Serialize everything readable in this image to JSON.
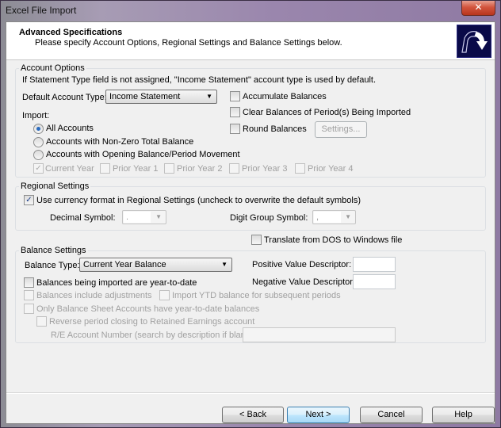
{
  "window": {
    "title": "Excel File Import",
    "close_label": "x"
  },
  "header": {
    "title": "Advanced Specifications",
    "subtitle": "Please specify Account Options, Regional Settings and Balance Settings below.",
    "icon": "wizard-arrow-icon"
  },
  "account_options": {
    "legend": "Account Options",
    "note": "If Statement Type field is not assigned, \"Income Statement\" account type is used by default.",
    "default_account_type_label": "Default Account Type:",
    "default_account_type_value": "Income Statement",
    "import_label": "Import:",
    "import_options": [
      {
        "label": "All Accounts",
        "selected": true
      },
      {
        "label": "Accounts with Non-Zero Total Balance",
        "selected": false
      },
      {
        "label": "Accounts with Opening Balance/Period Movement",
        "selected": false
      }
    ],
    "year_checkboxes": [
      {
        "label": "Current Year",
        "checked": true,
        "enabled": false
      },
      {
        "label": "Prior Year 1",
        "checked": false,
        "enabled": false
      },
      {
        "label": "Prior Year 2",
        "checked": false,
        "enabled": false
      },
      {
        "label": "Prior Year 3",
        "checked": false,
        "enabled": false
      },
      {
        "label": "Prior Year 4",
        "checked": false,
        "enabled": false
      }
    ],
    "accumulate_balances": {
      "label": "Accumulate Balances",
      "checked": false
    },
    "clear_balances": {
      "label": "Clear Balances of Period(s) Being Imported",
      "checked": false
    },
    "round_balances": {
      "label": "Round Balances",
      "checked": false
    },
    "settings_button": "Settings..."
  },
  "regional_settings": {
    "legend": "Regional Settings",
    "use_currency_format": {
      "label": "Use currency format in Regional Settings (uncheck to overwrite the default symbols)",
      "checked": true
    },
    "decimal_symbol_label": "Decimal Symbol:",
    "decimal_symbol_value": ".",
    "digit_group_symbol_label": "Digit Group Symbol:",
    "digit_group_symbol_value": ","
  },
  "translate_dos": {
    "label": "Translate from DOS to Windows file",
    "checked": false
  },
  "balance_settings": {
    "legend": "Balance Settings",
    "balance_type_label": "Balance Type:",
    "balance_type_value": "Current Year Balance",
    "positive_descriptor_label": "Positive Value Descriptor:",
    "positive_descriptor_value": "",
    "negative_descriptor_label": "Negative Value Descriptor:",
    "negative_descriptor_value": "",
    "ytd": {
      "label": "Balances being imported are year-to-date",
      "checked": false
    },
    "include_adjustments": {
      "label": "Balances include adjustments",
      "checked": false
    },
    "import_ytd_subsequent": {
      "label": "Import YTD balance for subsequent periods",
      "checked": false
    },
    "only_balance_sheet": {
      "label": "Only Balance Sheet Accounts have year-to-date balances",
      "checked": false
    },
    "reverse_period_closing": {
      "label": "Reverse period closing to Retained Earnings account",
      "checked": false
    },
    "re_account_label": "R/E Account Number (search by description if blank):",
    "re_account_value": ""
  },
  "footer": {
    "back": "< Back",
    "next": "Next >",
    "cancel": "Cancel",
    "help": "Help"
  }
}
